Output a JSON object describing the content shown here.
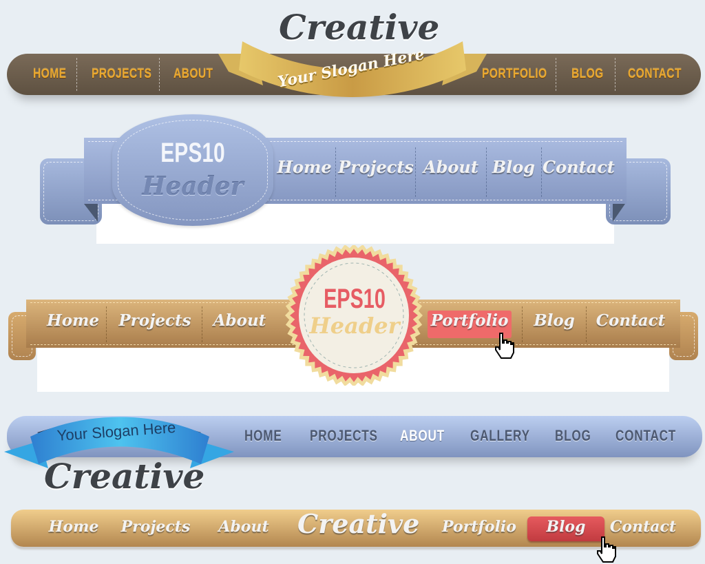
{
  "colors": {
    "background": "#e8eef3",
    "bar1_brown": "#6c5e4d",
    "bar1_text_gold": "#e9a830",
    "bar1_ribbon_gold": "#d9b560",
    "bar2_blue": "#98a9d1",
    "bar3_tan": "#c99c62",
    "bar3_active": "#ef6a6a",
    "bar3_seal_red": "#e9646a",
    "bar4_blue": "#a3b5de",
    "bar4_ribbon_blue": "#3aa0e0",
    "bar5_tan": "#d5aa6e",
    "bar5_active": "#d94a4f"
  },
  "header1": {
    "title": "Creative",
    "slogan": "Your Slogan Here",
    "nav_left": [
      "HOME",
      "PROJECTS",
      "ABOUT"
    ],
    "nav_right": [
      "PORTFOLIO",
      "BLOG",
      "CONTACT"
    ]
  },
  "header2": {
    "badge_line1": "EPS10",
    "badge_line2": "Header",
    "nav": [
      "Home",
      "Projects",
      "About",
      "Blog",
      "Contact"
    ]
  },
  "header3": {
    "badge_line1": "EPS10",
    "badge_line2": "Header",
    "nav_left": [
      "Home",
      "Projects",
      "About"
    ],
    "nav_right": [
      "Portfolio",
      "Blog",
      "Contact"
    ],
    "active_item": "Portfolio",
    "cursor_icon": "hand-pointer-icon"
  },
  "header4": {
    "slogan": "Your Slogan Here",
    "title": "Creative",
    "nav": [
      "HOME",
      "PROJECTS",
      "ABOUT",
      "GALLERY",
      "BLOG",
      "CONTACT"
    ],
    "active_item": "ABOUT"
  },
  "header5": {
    "title": "Creative",
    "nav_left": [
      "Home",
      "Projects",
      "About"
    ],
    "nav_right": [
      "Portfolio",
      "Blog",
      "Contact"
    ],
    "active_item": "Blog",
    "cursor_icon": "hand-pointer-icon"
  }
}
